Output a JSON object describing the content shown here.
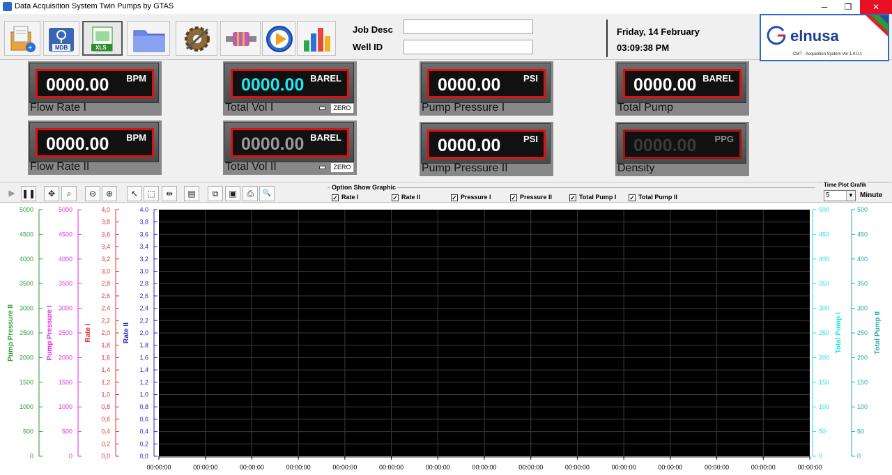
{
  "window": {
    "title": "Data Acquisition System Twin Pumps by GTAS",
    "minimize": "─",
    "maximize": "❐",
    "close": "✕"
  },
  "toolbar": {
    "buttons": [
      {
        "icon": "new-file-icon"
      },
      {
        "icon": "mdb-database-icon",
        "label": "MDB"
      },
      {
        "icon": "xls-export-icon",
        "label": "XLS"
      },
      {
        "icon": "folder-icon"
      },
      {
        "icon": "settings-gear-icon"
      },
      {
        "icon": "connector-icon"
      },
      {
        "icon": "play-icon"
      },
      {
        "icon": "bar-chart-icon"
      }
    ]
  },
  "job": {
    "job_desc_label": "Job Desc",
    "job_desc_value": "",
    "well_id_label": "Well ID",
    "well_id_value": ""
  },
  "clock": {
    "date": "Friday, 14 February",
    "time": "03:09:38 PM"
  },
  "logo": {
    "brand": "elnusa",
    "subtitle": "CMT - Acquisition System Ver 1.0.0.1"
  },
  "meters": {
    "flow_rate_1": {
      "value": "0000.00",
      "unit": "BPM",
      "caption": "Flow Rate I"
    },
    "total_vol_1": {
      "value": "0000.00",
      "unit": "BAREL",
      "caption": "Total Vol I",
      "zero": "ZERO"
    },
    "pump_pressure_1": {
      "value": "0000.00",
      "unit": "PSI",
      "caption": "Pump Pressure I"
    },
    "total_pump": {
      "value": "0000.00",
      "unit": "BAREL",
      "caption": "Total Pump"
    },
    "flow_rate_2": {
      "value": "0000.00",
      "unit": "BPM",
      "caption": "Flow Rate II"
    },
    "total_vol_2": {
      "value": "0000.00",
      "unit": "BAREL",
      "caption": "Total Vol II",
      "zero": "ZERO"
    },
    "pump_pressure_2": {
      "value": "0000.00",
      "unit": "PSI",
      "caption": "Pump Pressure II"
    },
    "density": {
      "value": "0000.00",
      "unit": "PPG",
      "caption": "Density"
    }
  },
  "chart_toolbar": {
    "buttons": [
      "play-icon",
      "pause-icon",
      "pan-icon",
      "zoom-box-icon",
      "zoom-out-icon",
      "zoom-in-icon",
      "pointer-icon",
      "select-rect-icon",
      "split-icon",
      "properties-icon",
      "copy-icon",
      "save-icon",
      "print-icon",
      "print-preview-icon"
    ],
    "glyphs": {
      "play": "▶",
      "pause": "❚❚",
      "pan": "✥",
      "zoom_box": "⌕",
      "zoom_out": "⊖",
      "zoom_in": "⊕",
      "pointer": "↖",
      "select_rect": "⬚",
      "split": "⇹",
      "properties": "▤",
      "copy": "⧉",
      "save": "▣",
      "print": "⎙",
      "print_preview": "🔍"
    }
  },
  "option_show_graphic": {
    "title": "Option Show Graphic",
    "options": [
      {
        "label": "Rate I",
        "checked": true
      },
      {
        "label": "Rate II",
        "checked": true
      },
      {
        "label": "Pressure I",
        "checked": true
      },
      {
        "label": "Pressure II",
        "checked": true
      },
      {
        "label": "Total Pump I",
        "checked": true
      },
      {
        "label": "Total Pump II",
        "checked": true
      }
    ],
    "check_glyph": "✓"
  },
  "time_plot": {
    "title": "Time Plot Grafik",
    "value": "5",
    "unit": "Minute",
    "arrow": "▼"
  },
  "colors": {
    "pump_pressure_2": "#2e9a2e",
    "pump_pressure_1": "#e32ee3",
    "rate_1": "#e03030",
    "rate_2": "#2a2ac0",
    "total_pump_1": "#22e0e0",
    "total_pump_2": "#22a8a8",
    "plot_bg": "#000000",
    "grid": "#3a3a3a"
  },
  "chart_data": {
    "type": "line",
    "x_tick_labels": [
      "00:00:00",
      "00:00:00",
      "00:00:00",
      "00:00:00",
      "00:00:00",
      "00:00:00",
      "00:00:00",
      "00:00:00",
      "00:00:00",
      "00:00:00",
      "00:00:00",
      "00:00:00",
      "00:00:00",
      "00:00:00",
      "00:00:00"
    ],
    "axes": [
      {
        "key": "pump_pressure_2",
        "label": "Pump Pressure II",
        "ylim": [
          0,
          5000
        ],
        "ticks": [
          "0",
          "500",
          "1000",
          "1500",
          "2000",
          "2500",
          "3000",
          "3500",
          "4000",
          "4500",
          "5000"
        ]
      },
      {
        "key": "pump_pressure_1",
        "label": "Pump Pressure I",
        "ylim": [
          0,
          5000
        ],
        "ticks": [
          "0",
          "500",
          "1000",
          "1500",
          "2000",
          "2500",
          "3000",
          "3500",
          "4000",
          "4500",
          "5000"
        ]
      },
      {
        "key": "rate_1",
        "label": "Rate I",
        "ylim": [
          0,
          4
        ],
        "ticks": [
          "0,0",
          "0,2",
          "0,4",
          "0,6",
          "0,8",
          "1,0",
          "1,2",
          "1,4",
          "1,6",
          "1,8",
          "2,0",
          "2,2",
          "2,4",
          "2,6",
          "2,8",
          "3,0",
          "3,2",
          "3,4",
          "3,6",
          "3,8",
          "4,0"
        ]
      },
      {
        "key": "rate_2",
        "label": "Rate II",
        "ylim": [
          0,
          4
        ],
        "ticks": [
          "0,0",
          "0,2",
          "0,4",
          "0,6",
          "0,8",
          "1,0",
          "1,2",
          "1,4",
          "1,6",
          "1,8",
          "2,0",
          "2,2",
          "2,4",
          "2,6",
          "2,8",
          "3,0",
          "3,2",
          "3,4",
          "3,6",
          "3,8",
          "4,0"
        ]
      },
      {
        "key": "total_pump_1",
        "label": "Total Pump I",
        "ylim": [
          0,
          500
        ],
        "ticks": [
          "0",
          "50",
          "100",
          "150",
          "200",
          "250",
          "300",
          "350",
          "400",
          "450",
          "500"
        ]
      },
      {
        "key": "total_pump_2",
        "label": "Total Pump II",
        "ylim": [
          0,
          500
        ],
        "ticks": [
          "0",
          "50",
          "100",
          "150",
          "200",
          "250",
          "300",
          "350",
          "400",
          "450",
          "500"
        ]
      }
    ],
    "series": [],
    "grid": true
  }
}
